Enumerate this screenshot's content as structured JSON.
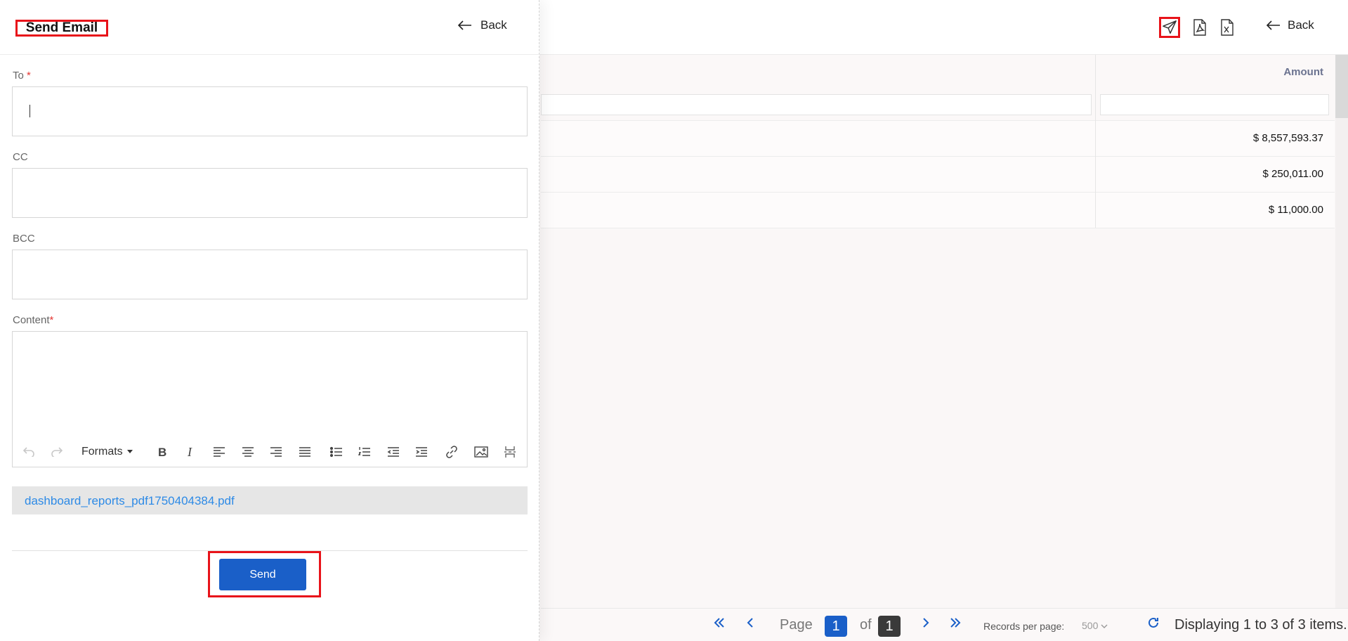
{
  "email_panel": {
    "title": "Send Email",
    "back_label": "Back",
    "to_label": "To",
    "to_required": "*",
    "to_value": "",
    "cc_label": "CC",
    "cc_value": "",
    "bcc_label": "BCC",
    "bcc_value": "",
    "content_label": "Content",
    "content_required": "*",
    "editor": {
      "formats_label": "Formats",
      "tools": [
        "undo-icon",
        "redo-icon",
        "bold-icon",
        "italic-icon",
        "align-left-icon",
        "align-center-icon",
        "align-right-icon",
        "align-justify-icon",
        "bullet-list-icon",
        "numbered-list-icon",
        "outdent-icon",
        "indent-icon",
        "link-icon",
        "image-icon",
        "page-break-icon"
      ]
    },
    "attachment": "dashboard_reports_pdf1750404384.pdf",
    "send_label": "Send"
  },
  "report": {
    "back_label": "Back",
    "toolbar_icons": [
      "send-icon",
      "pdf-icon",
      "excel-icon"
    ],
    "columns": {
      "amount": "Amount"
    },
    "rows": [
      {
        "amount": "$ 8,557,593.37"
      },
      {
        "amount": "$ 250,011.00"
      },
      {
        "amount": "$ 11,000.00"
      }
    ],
    "pagination": {
      "page_label": "Page",
      "current_page": "1",
      "of_label": "of",
      "total_pages": "1",
      "records_per_page_label": "Records per page:",
      "records_per_page": "500",
      "display_text": "Displaying 1 to 3 of 3 items."
    }
  },
  "colors": {
    "accent": "#1a5fc8",
    "highlight": "#e8131a",
    "link": "#2d8ae6",
    "page_box_dark": "#3a3a3a"
  }
}
